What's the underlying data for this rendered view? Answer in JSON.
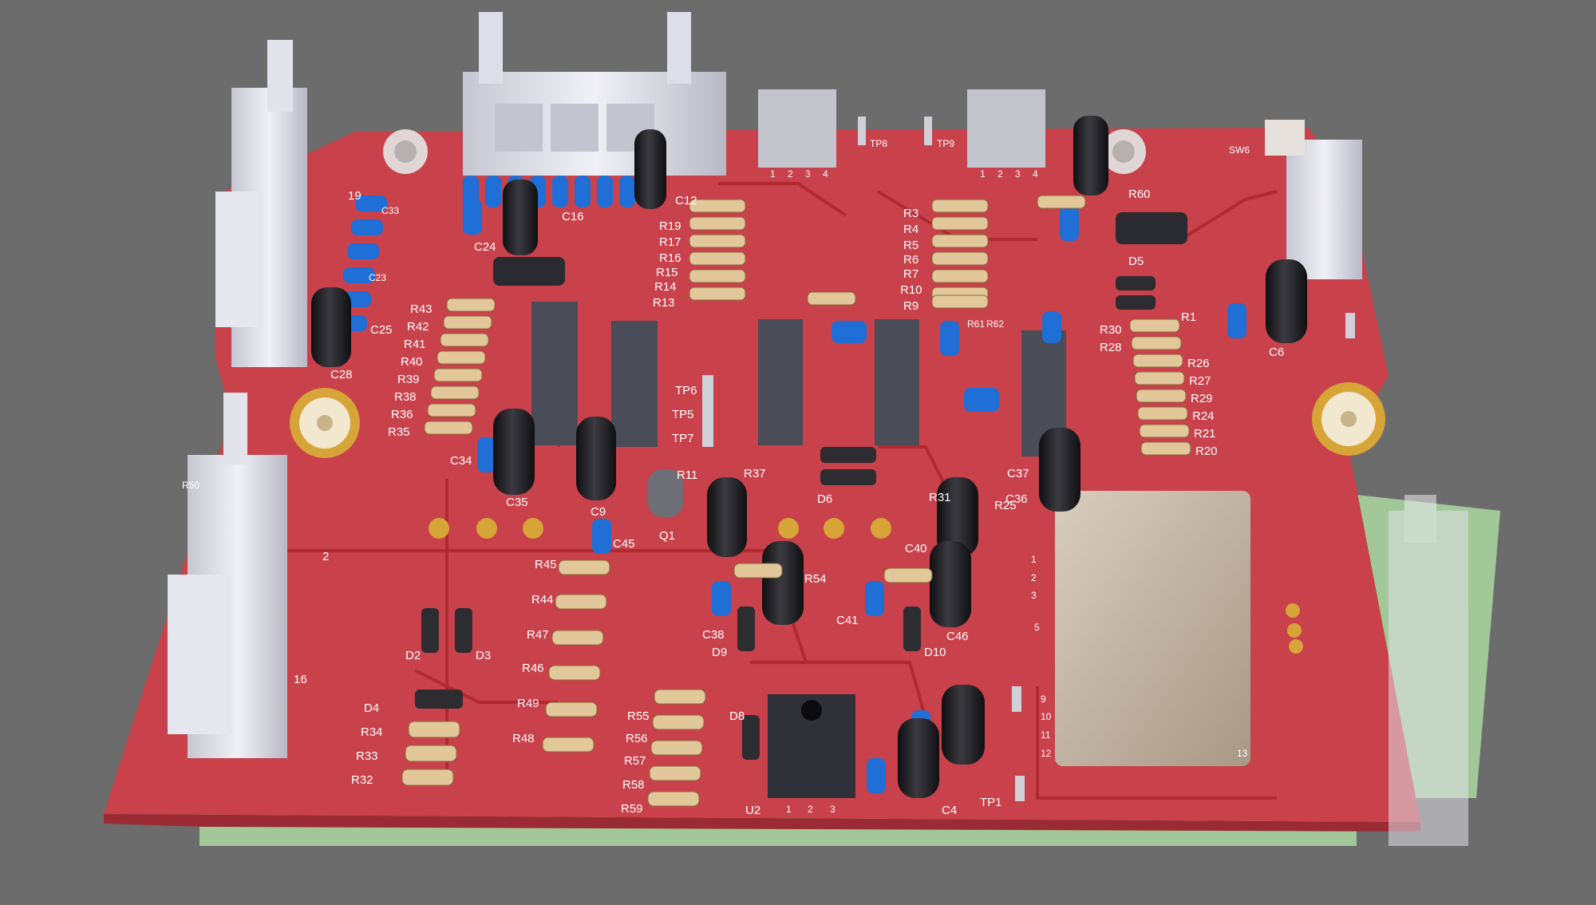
{
  "scene": {
    "description_free": true,
    "colors": {
      "background": "#6c6c6c",
      "pcb_top": "#c8414b",
      "pcb_edge": "#9a2a33",
      "pcb_bottom": "#a9d3a0",
      "trace": "#b02a32",
      "silkscreen": "#ffffff",
      "ic_body": "#4a4d58",
      "capacitor_black": "#1d1d20",
      "capacitor_blue": "#1f6fd6",
      "resistor_body": "#e2c79a",
      "connector": "#d9d9e3",
      "transformer": "#c8b8a6",
      "pad_gold": "#d6a437"
    }
  },
  "labels": {
    "resistors_left": [
      "R43",
      "R42",
      "R41",
      "R40",
      "R39",
      "R38",
      "R36",
      "R35"
    ],
    "resistors_top_mid": [
      "R19",
      "R17",
      "R16",
      "R15",
      "R14",
      "R13"
    ],
    "resistors_top_right": [
      "R3",
      "R4",
      "R5",
      "R6",
      "R7",
      "R10",
      "R9"
    ],
    "resistors_right": [
      "R30",
      "R28",
      "R26",
      "R27",
      "R29",
      "R24",
      "R21",
      "R20"
    ],
    "resistors_bottom_left": [
      "R34",
      "R33",
      "R32"
    ],
    "resistors_bottom_mid_a": [
      "R45",
      "R44",
      "R47",
      "R46",
      "R49",
      "R48"
    ],
    "resistors_bottom_mid_b": [
      "R55",
      "R56",
      "R57",
      "R58",
      "R59"
    ],
    "caps_left": [
      "C33",
      "C23",
      "C25",
      "C28"
    ],
    "misc": {
      "c24": "C24",
      "c16": "C16",
      "c12": "C12",
      "c34": "C34",
      "c35": "C35",
      "c9": "C9",
      "c45": "C45",
      "q1": "Q1",
      "tp6": "TP6",
      "tp5": "TP5",
      "tp7": "TP7",
      "tp8": "TP8",
      "tp9": "TP9",
      "tp1": "TP1",
      "r37": "R37",
      "r11": "R11",
      "d6": "D6",
      "d5": "D5",
      "r31": "R31",
      "r25": "R25",
      "c37": "C37",
      "c36": "C36",
      "c40": "C40",
      "r54": "R54",
      "c41": "C41",
      "c46": "C46",
      "c38": "C38",
      "d9": "D9",
      "d10": "D10",
      "d8": "D8",
      "d2": "D2",
      "d3": "D3",
      "d4": "D4",
      "u2": "U2",
      "c4": "C4",
      "c6": "C6",
      "r60": "R60",
      "r1": "R1",
      "sw6": "SW6",
      "r50": "R50",
      "r61": "R61",
      "r62": "R62",
      "pin_1": "1",
      "pin_2": "2",
      "pin_3": "3",
      "hdr_1": "1",
      "hdr_2": "2",
      "hdr_3": "3",
      "hdr_4": "4",
      "t_1": "1",
      "t_2": "2",
      "t_3": "3",
      "t_5": "5",
      "t_9": "9",
      "t_10": "10",
      "t_11": "11",
      "t_12": "12",
      "t_13": "13",
      "j_16": "16",
      "j_2": "2",
      "j_19": "19"
    }
  }
}
